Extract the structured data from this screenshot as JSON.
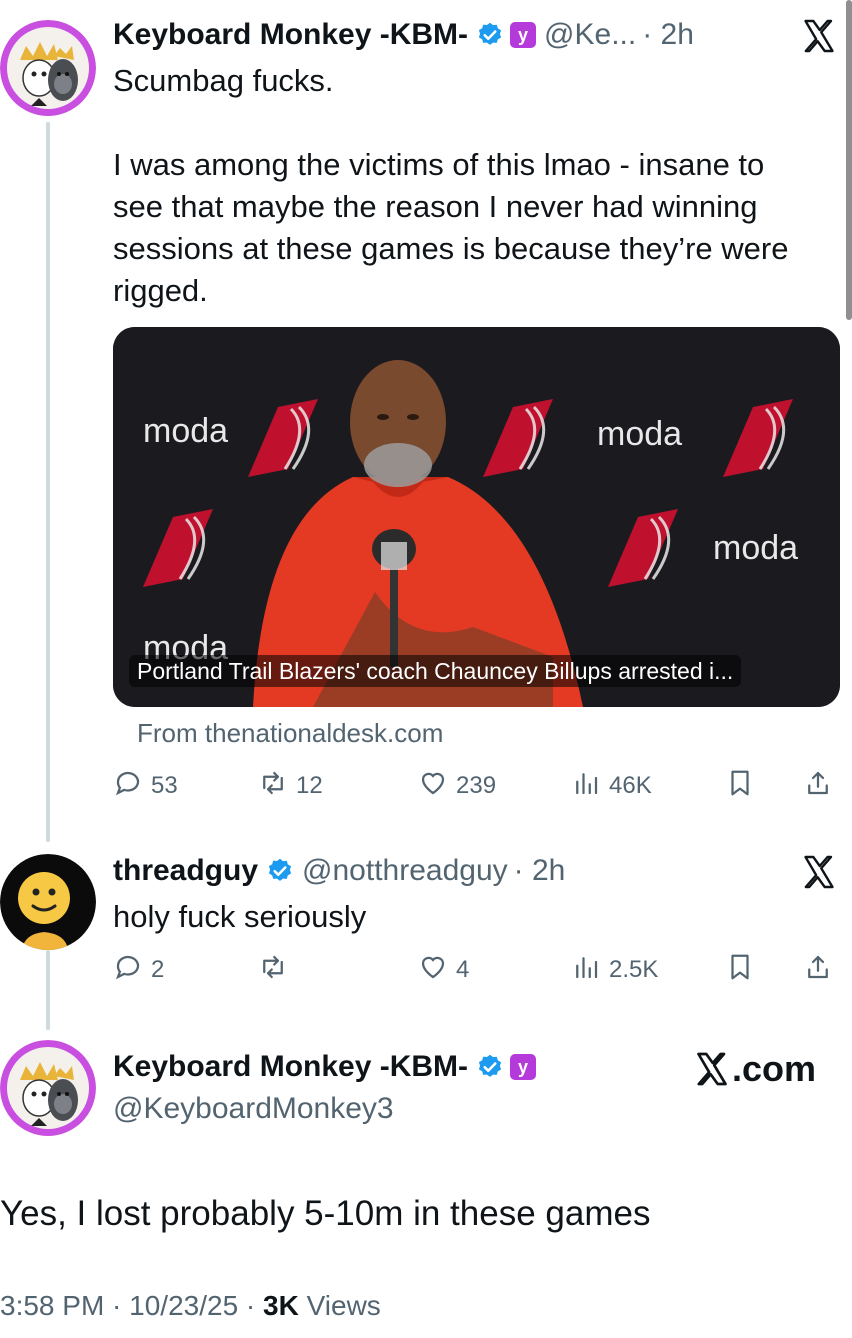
{
  "tweet1": {
    "display_name": "Keyboard Monkey -KBM-",
    "handle": "@Ke...",
    "time": "· 2h",
    "text_lines": [
      "Scumbag fucks.",
      "",
      "I was among the victims of this lmao - insane to",
      "see that maybe the reason I never had winning",
      "sessions at these games is because they’re were",
      "rigged."
    ],
    "media": {
      "caption": "Portland Trail Blazers' coach Chauncey Billups arrested i...",
      "backdrop_text": "moda"
    },
    "source": "From thenationaldesk.com",
    "stats": {
      "replies": "53",
      "reposts": "12",
      "likes": "239",
      "views": "46K"
    }
  },
  "tweet2": {
    "display_name": "threadguy",
    "handle": "@notthreadguy",
    "time": "· 2h",
    "text": "holy fuck seriously",
    "stats": {
      "replies": "2",
      "reposts": "",
      "likes": "4",
      "views": "2.5K"
    }
  },
  "tweet3": {
    "display_name": "Keyboard Monkey -KBM-",
    "handle": "@KeyboardMonkey3",
    "brand": ".com",
    "text": "Yes, I lost probably 5-10m in these games",
    "meta_time": "3:58 PM · 10/23/25 · ",
    "meta_views_count": "3K",
    "meta_views_label": " Views"
  },
  "colors": {
    "verified": "#1d9bf0",
    "affiliate": "#b43bd9",
    "secondary_text": "#536471",
    "thread_line": "#cfd9de",
    "avatar_ring": "#c84fe0"
  },
  "icons": [
    "verified-badge-icon",
    "affiliate-badge-icon",
    "x-logo-icon",
    "reply-icon",
    "repost-icon",
    "like-icon",
    "views-icon",
    "bookmark-icon",
    "share-icon"
  ]
}
